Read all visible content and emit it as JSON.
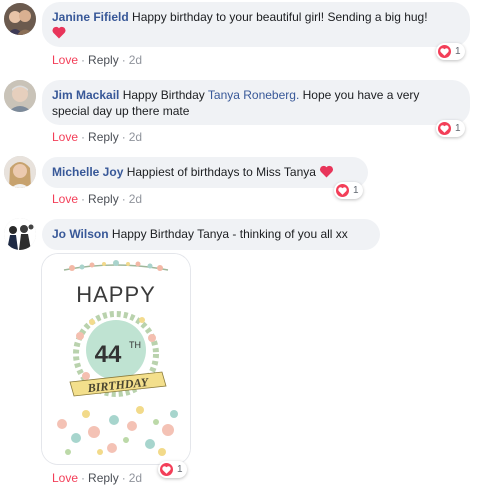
{
  "comments": [
    {
      "name": "Janine Fifield",
      "text": "Happy birthday to your beautiful girl! Sending a big hug!",
      "reaction_count": "1",
      "actions": {
        "love": "Love",
        "reply": "Reply",
        "time": "2d"
      }
    },
    {
      "name": "Jim Mackail",
      "text_before": "Happy Birthday",
      "mention": "Tanya Roneberg.",
      "text_after": "Hope you have a very special day up there mate",
      "reaction_count": "1",
      "actions": {
        "love": "Love",
        "reply": "Reply",
        "time": "2d"
      }
    },
    {
      "name": "Michelle Joy",
      "text": "Happiest of birthdays to Miss Tanya",
      "reaction_count": "1",
      "actions": {
        "love": "Love",
        "reply": "Reply",
        "time": "2d"
      }
    },
    {
      "name": "Jo Wilson",
      "text": "Happy Birthday Tanya - thinking of you all xx",
      "reaction_count": "1",
      "actions": {
        "love": "Love",
        "reply": "Reply",
        "time": "2d"
      },
      "card": {
        "line1": "HAPPY",
        "number": "44",
        "suffix": "TH",
        "banner": "BIRTHDAY"
      }
    }
  ],
  "colors": {
    "name": "#385898",
    "love": "#f33e58",
    "bubble": "#f0f2f5"
  }
}
